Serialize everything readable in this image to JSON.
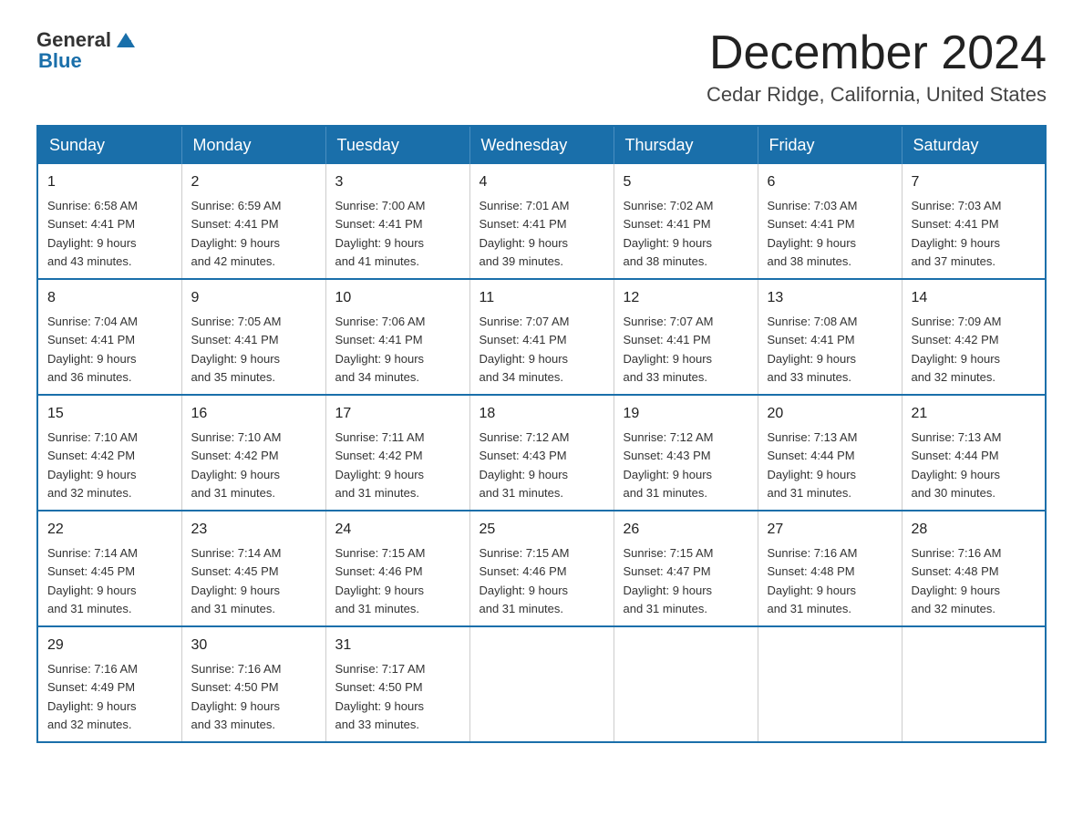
{
  "header": {
    "logo_general": "General",
    "logo_blue": "Blue",
    "month_title": "December 2024",
    "location": "Cedar Ridge, California, United States"
  },
  "weekdays": [
    "Sunday",
    "Monday",
    "Tuesday",
    "Wednesday",
    "Thursday",
    "Friday",
    "Saturday"
  ],
  "weeks": [
    [
      {
        "day": "1",
        "sunrise": "6:58 AM",
        "sunset": "4:41 PM",
        "daylight": "9 hours and 43 minutes."
      },
      {
        "day": "2",
        "sunrise": "6:59 AM",
        "sunset": "4:41 PM",
        "daylight": "9 hours and 42 minutes."
      },
      {
        "day": "3",
        "sunrise": "7:00 AM",
        "sunset": "4:41 PM",
        "daylight": "9 hours and 41 minutes."
      },
      {
        "day": "4",
        "sunrise": "7:01 AM",
        "sunset": "4:41 PM",
        "daylight": "9 hours and 39 minutes."
      },
      {
        "day": "5",
        "sunrise": "7:02 AM",
        "sunset": "4:41 PM",
        "daylight": "9 hours and 38 minutes."
      },
      {
        "day": "6",
        "sunrise": "7:03 AM",
        "sunset": "4:41 PM",
        "daylight": "9 hours and 38 minutes."
      },
      {
        "day": "7",
        "sunrise": "7:03 AM",
        "sunset": "4:41 PM",
        "daylight": "9 hours and 37 minutes."
      }
    ],
    [
      {
        "day": "8",
        "sunrise": "7:04 AM",
        "sunset": "4:41 PM",
        "daylight": "9 hours and 36 minutes."
      },
      {
        "day": "9",
        "sunrise": "7:05 AM",
        "sunset": "4:41 PM",
        "daylight": "9 hours and 35 minutes."
      },
      {
        "day": "10",
        "sunrise": "7:06 AM",
        "sunset": "4:41 PM",
        "daylight": "9 hours and 34 minutes."
      },
      {
        "day": "11",
        "sunrise": "7:07 AM",
        "sunset": "4:41 PM",
        "daylight": "9 hours and 34 minutes."
      },
      {
        "day": "12",
        "sunrise": "7:07 AM",
        "sunset": "4:41 PM",
        "daylight": "9 hours and 33 minutes."
      },
      {
        "day": "13",
        "sunrise": "7:08 AM",
        "sunset": "4:41 PM",
        "daylight": "9 hours and 33 minutes."
      },
      {
        "day": "14",
        "sunrise": "7:09 AM",
        "sunset": "4:42 PM",
        "daylight": "9 hours and 32 minutes."
      }
    ],
    [
      {
        "day": "15",
        "sunrise": "7:10 AM",
        "sunset": "4:42 PM",
        "daylight": "9 hours and 32 minutes."
      },
      {
        "day": "16",
        "sunrise": "7:10 AM",
        "sunset": "4:42 PM",
        "daylight": "9 hours and 31 minutes."
      },
      {
        "day": "17",
        "sunrise": "7:11 AM",
        "sunset": "4:42 PM",
        "daylight": "9 hours and 31 minutes."
      },
      {
        "day": "18",
        "sunrise": "7:12 AM",
        "sunset": "4:43 PM",
        "daylight": "9 hours and 31 minutes."
      },
      {
        "day": "19",
        "sunrise": "7:12 AM",
        "sunset": "4:43 PM",
        "daylight": "9 hours and 31 minutes."
      },
      {
        "day": "20",
        "sunrise": "7:13 AM",
        "sunset": "4:44 PM",
        "daylight": "9 hours and 31 minutes."
      },
      {
        "day": "21",
        "sunrise": "7:13 AM",
        "sunset": "4:44 PM",
        "daylight": "9 hours and 30 minutes."
      }
    ],
    [
      {
        "day": "22",
        "sunrise": "7:14 AM",
        "sunset": "4:45 PM",
        "daylight": "9 hours and 31 minutes."
      },
      {
        "day": "23",
        "sunrise": "7:14 AM",
        "sunset": "4:45 PM",
        "daylight": "9 hours and 31 minutes."
      },
      {
        "day": "24",
        "sunrise": "7:15 AM",
        "sunset": "4:46 PM",
        "daylight": "9 hours and 31 minutes."
      },
      {
        "day": "25",
        "sunrise": "7:15 AM",
        "sunset": "4:46 PM",
        "daylight": "9 hours and 31 minutes."
      },
      {
        "day": "26",
        "sunrise": "7:15 AM",
        "sunset": "4:47 PM",
        "daylight": "9 hours and 31 minutes."
      },
      {
        "day": "27",
        "sunrise": "7:16 AM",
        "sunset": "4:48 PM",
        "daylight": "9 hours and 31 minutes."
      },
      {
        "day": "28",
        "sunrise": "7:16 AM",
        "sunset": "4:48 PM",
        "daylight": "9 hours and 32 minutes."
      }
    ],
    [
      {
        "day": "29",
        "sunrise": "7:16 AM",
        "sunset": "4:49 PM",
        "daylight": "9 hours and 32 minutes."
      },
      {
        "day": "30",
        "sunrise": "7:16 AM",
        "sunset": "4:50 PM",
        "daylight": "9 hours and 33 minutes."
      },
      {
        "day": "31",
        "sunrise": "7:17 AM",
        "sunset": "4:50 PM",
        "daylight": "9 hours and 33 minutes."
      },
      null,
      null,
      null,
      null
    ]
  ],
  "labels": {
    "sunrise": "Sunrise:",
    "sunset": "Sunset:",
    "daylight": "Daylight:"
  }
}
